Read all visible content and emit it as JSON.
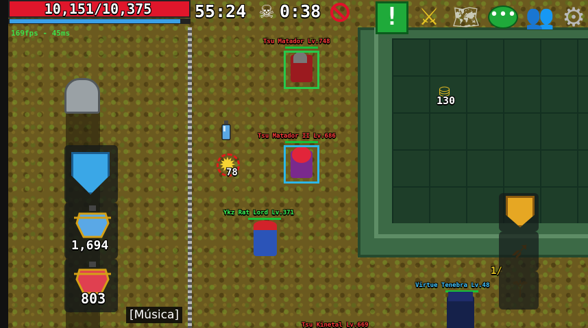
{
  "hud": {
    "hp": "10,151/10,375",
    "hp_fraction": 0.978,
    "mana_fraction": 0.95,
    "fps": "169fps - 45ms",
    "timer": "55:24",
    "skull_timer": "0:38"
  },
  "toolbar": {
    "quest_label": "!",
    "icons": [
      "quest-alert-icon",
      "crossed-swords-icon",
      "map-icon",
      "chat-bubble-icon",
      "friends-icon",
      "gear-icon"
    ]
  },
  "players": [
    {
      "name": "Tsu Matador Lv.748",
      "color": "#ff3b3b"
    },
    {
      "name": "Tsu Matador II Lv.686",
      "color": "#ff3b3b"
    },
    {
      "name": "Ykz Rat Lord Lv.371",
      "color": "#3dff5a"
    },
    {
      "name": "Virtue Tenebra Lv.48",
      "color": "#42c6ff"
    },
    {
      "name": "Tsu Kinetal Lv.669",
      "color": "#ff3b3b"
    }
  ],
  "world": {
    "item_count": "130",
    "enemy_count": "78"
  },
  "inventory": {
    "potion1_count": "1,694",
    "potion2_count": "803"
  },
  "actions": {
    "slot_fraction": "1/"
  },
  "caption": "[Música]",
  "colors": {
    "hp": "#e0162b",
    "mana": "#3aa0e8",
    "fps": "#3ee04a",
    "accent_green": "#1faa3a"
  }
}
